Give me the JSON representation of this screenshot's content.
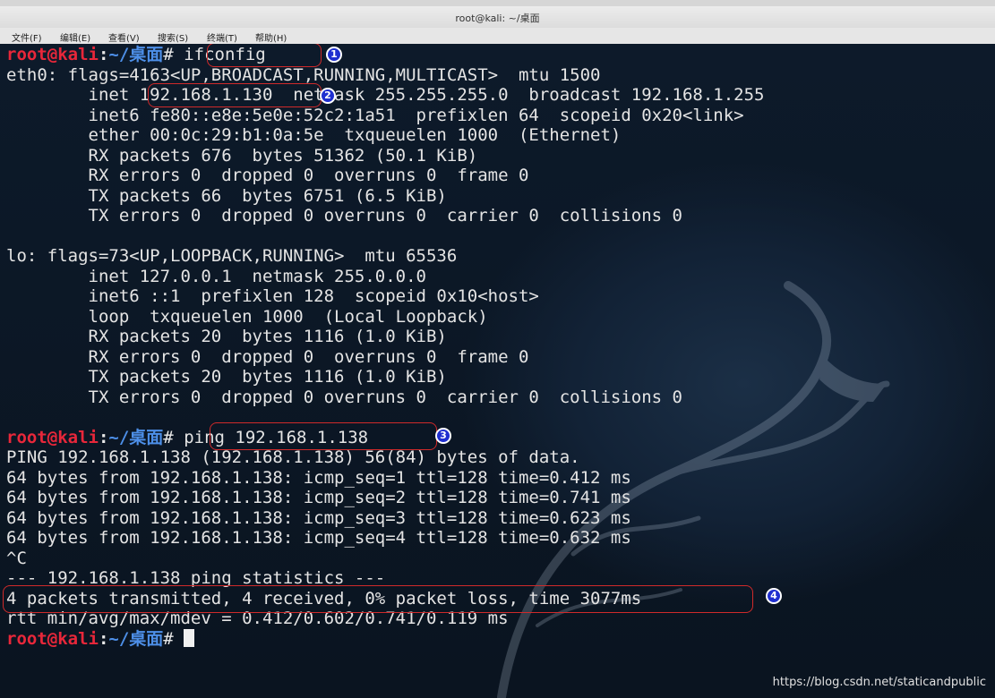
{
  "window": {
    "title": "root@kali: ~/桌面"
  },
  "menu": [
    "文件(F)",
    "编辑(E)",
    "查看(V)",
    "搜索(S)",
    "终端(T)",
    "帮助(H)"
  ],
  "prompt": {
    "user": "root@kali",
    "colon": ":",
    "path": "~/桌面",
    "hash": "# "
  },
  "lines": [
    {
      "type": "cmd",
      "cmd": "ifconfig"
    },
    {
      "type": "out",
      "text": "eth0: flags=4163<UP,BROADCAST,RUNNING,MULTICAST>  mtu 1500"
    },
    {
      "type": "out",
      "text": "        inet 192.168.1.130  netmask 255.255.255.0  broadcast 192.168.1.255"
    },
    {
      "type": "out",
      "text": "        inet6 fe80::e8e:5e0e:52c2:1a51  prefixlen 64  scopeid 0x20<link>"
    },
    {
      "type": "out",
      "text": "        ether 00:0c:29:b1:0a:5e  txqueuelen 1000  (Ethernet)"
    },
    {
      "type": "out",
      "text": "        RX packets 676  bytes 51362 (50.1 KiB)"
    },
    {
      "type": "out",
      "text": "        RX errors 0  dropped 0  overruns 0  frame 0"
    },
    {
      "type": "out",
      "text": "        TX packets 66  bytes 6751 (6.5 KiB)"
    },
    {
      "type": "out",
      "text": "        TX errors 0  dropped 0 overruns 0  carrier 0  collisions 0"
    },
    {
      "type": "out",
      "text": ""
    },
    {
      "type": "out",
      "text": "lo: flags=73<UP,LOOPBACK,RUNNING>  mtu 65536"
    },
    {
      "type": "out",
      "text": "        inet 127.0.0.1  netmask 255.0.0.0"
    },
    {
      "type": "out",
      "text": "        inet6 ::1  prefixlen 128  scopeid 0x10<host>"
    },
    {
      "type": "out",
      "text": "        loop  txqueuelen 1000  (Local Loopback)"
    },
    {
      "type": "out",
      "text": "        RX packets 20  bytes 1116 (1.0 KiB)"
    },
    {
      "type": "out",
      "text": "        RX errors 0  dropped 0  overruns 0  frame 0"
    },
    {
      "type": "out",
      "text": "        TX packets 20  bytes 1116 (1.0 KiB)"
    },
    {
      "type": "out",
      "text": "        TX errors 0  dropped 0 overruns 0  carrier 0  collisions 0"
    },
    {
      "type": "out",
      "text": ""
    },
    {
      "type": "cmd",
      "cmd": "ping 192.168.1.138"
    },
    {
      "type": "out",
      "text": "PING 192.168.1.138 (192.168.1.138) 56(84) bytes of data."
    },
    {
      "type": "out",
      "text": "64 bytes from 192.168.1.138: icmp_seq=1 ttl=128 time=0.412 ms"
    },
    {
      "type": "out",
      "text": "64 bytes from 192.168.1.138: icmp_seq=2 ttl=128 time=0.741 ms"
    },
    {
      "type": "out",
      "text": "64 bytes from 192.168.1.138: icmp_seq=3 ttl=128 time=0.623 ms"
    },
    {
      "type": "out",
      "text": "64 bytes from 192.168.1.138: icmp_seq=4 ttl=128 time=0.632 ms"
    },
    {
      "type": "out",
      "text": "^C"
    },
    {
      "type": "out",
      "text": "--- 192.168.1.138 ping statistics ---"
    },
    {
      "type": "out",
      "text": "4 packets transmitted, 4 received, 0% packet loss, time 3077ms"
    },
    {
      "type": "out",
      "text": "rtt min/avg/max/mdev = 0.412/0.602/0.741/0.119 ms"
    },
    {
      "type": "cmd",
      "cmd": "",
      "cursor": true
    }
  ],
  "annotations": [
    "1",
    "2",
    "3",
    "4"
  ],
  "watermark": "https://blog.csdn.net/staticandpublic",
  "colors": {
    "prompt_user": "#e8273a",
    "prompt_path": "#4d8fe8",
    "annotation_box": "#d02a2a",
    "badge": "#1f2fd0"
  }
}
